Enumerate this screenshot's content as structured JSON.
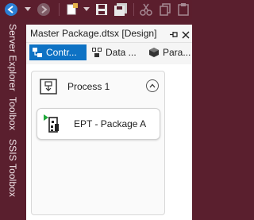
{
  "toolbar": {
    "icons": [
      "back-icon",
      "forward-icon",
      "new-item-icon",
      "save-icon",
      "save-all-icon",
      "cut-icon",
      "copy-icon",
      "paste-icon"
    ]
  },
  "side_tabs": [
    "Server Explorer",
    "Toolbox",
    "SSIS Toolbox"
  ],
  "document": {
    "title": "Master Package.dtsx [Design]",
    "pin_glyph": "⊣",
    "close_glyph": "✕"
  },
  "designer_tabs": [
    {
      "label": "Contr...",
      "active": true
    },
    {
      "label": "Data ...",
      "active": false
    },
    {
      "label": "Para...",
      "active": false
    }
  ],
  "canvas": {
    "container": {
      "title": "Process 1",
      "collapse_glyph": "^"
    },
    "task": {
      "label": "EPT - Package A"
    }
  },
  "colors": {
    "chrome_background": "#5a1f2e",
    "active_tab": "#0e72c4",
    "task_indicator": "#1fa83a"
  }
}
